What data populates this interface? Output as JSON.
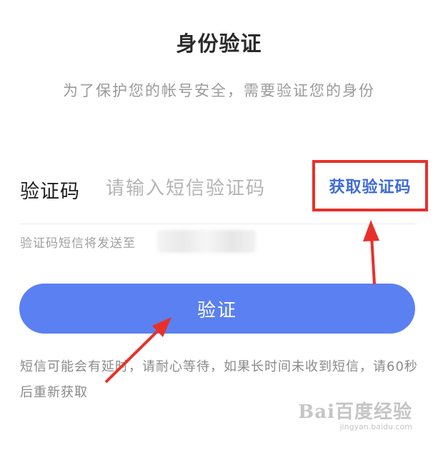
{
  "header": {
    "title": "身份验证",
    "subtitle": "为了保护您的帐号安全，需要验证您的身份"
  },
  "form": {
    "code_label": "验证码",
    "code_placeholder": "请输入短信验证码",
    "get_code_button": "获取验证码",
    "send_hint": "验证码短信将发送至"
  },
  "actions": {
    "verify_button": "验证"
  },
  "notice": {
    "text": "短信可能会有延时，请耐心等待，如果长时间未收到短信，请60秒后重新获取"
  },
  "annotations": {
    "highlight_color": "#e8302a",
    "arrow_color": "#e8302a"
  },
  "watermark": {
    "logo": "Bai百度经验",
    "url": "jingyan.baidu.com"
  },
  "colors": {
    "accent": "#5b80f2",
    "link": "#3f6bd8"
  }
}
